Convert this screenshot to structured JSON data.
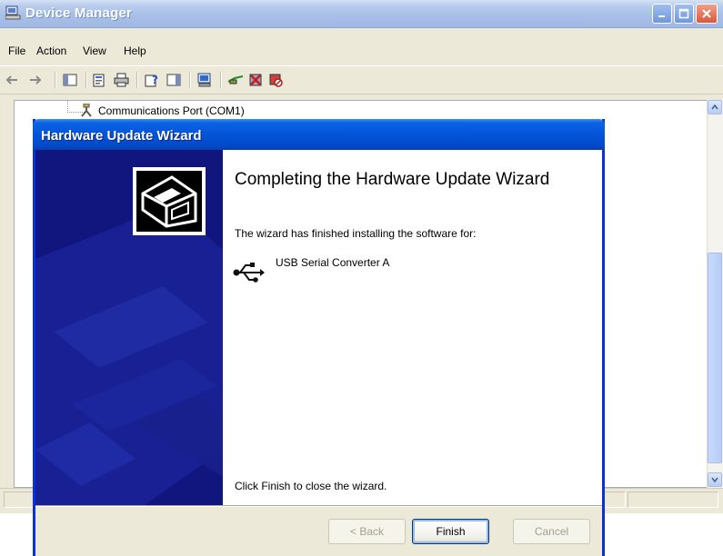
{
  "device_manager": {
    "title": "Device Manager",
    "menu": [
      "File",
      "Action",
      "View",
      "Help"
    ],
    "toolbar_icons": [
      "back-arrow-icon",
      "forward-arrow-icon",
      "show-hide-tree-icon",
      "properties-icon",
      "print-icon",
      "help-icon",
      "show-hide-action-pane-icon",
      "scan-hardware-icon",
      "update-driver-icon",
      "uninstall-icon",
      "disable-device-icon"
    ],
    "tree_item": "Communications Port (COM1)"
  },
  "wizard": {
    "title": "Hardware Update Wizard",
    "heading": "Completing the Hardware Update Wizard",
    "description": "The wizard has finished installing the software for:",
    "device_name": "USB Serial Converter A",
    "footer_text": "Click Finish to close the wizard.",
    "buttons": {
      "back": "< Back",
      "finish": "Finish",
      "cancel": "Cancel"
    }
  },
  "colors": {
    "wizard_titlebar": "#0454d8",
    "wizard_sidebar": "#10167e",
    "dm_titlebar": "#a8c0e8",
    "close_button": "#d9583a"
  }
}
